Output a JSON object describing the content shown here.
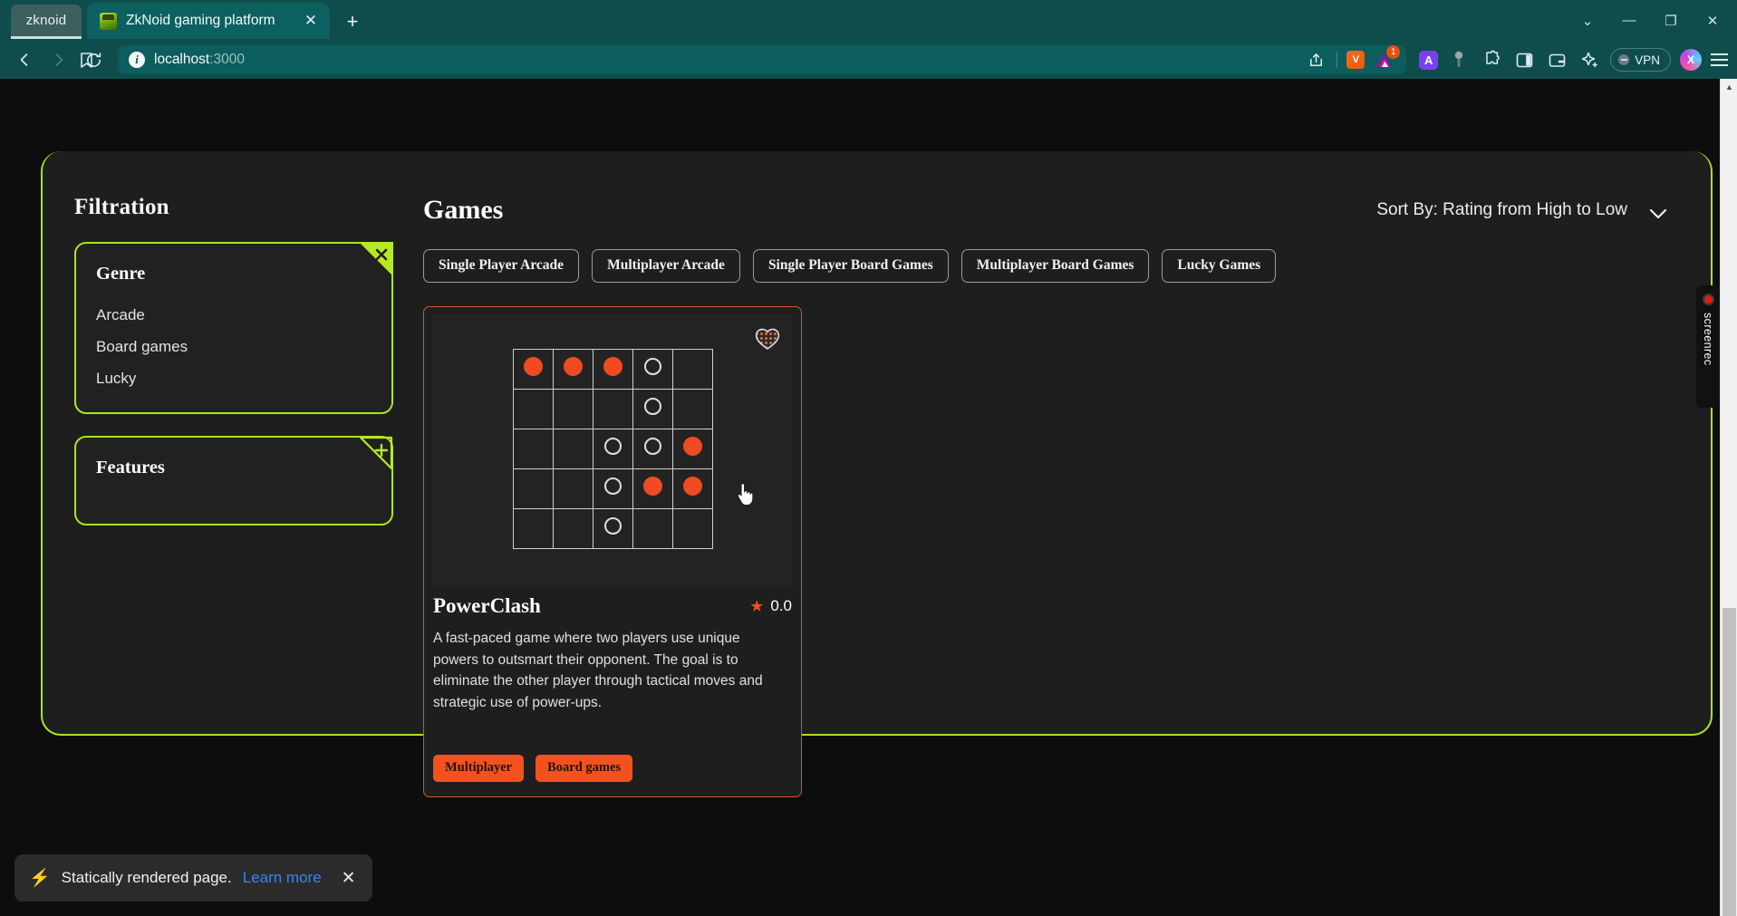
{
  "browser": {
    "workspace": "zknoid",
    "tab": {
      "title": "ZkNoid gaming platform",
      "close": "✕",
      "favicon": "zknoid-favicon"
    },
    "new_tab": "+",
    "window_controls": {
      "chevron": "⌄",
      "minimize": "—",
      "restore": "❐",
      "close": "✕"
    },
    "nav": {
      "back": "‹",
      "forward": "›",
      "reload": "⟳",
      "bookmark": "bookmark-icon"
    },
    "address": {
      "host": "localhost",
      "port": ":3000",
      "info": "i"
    },
    "toolbar_right": {
      "share": "share-icon",
      "brave_shield": "brave-shield-icon",
      "extension_badge": "1",
      "a_extension": "A",
      "profile_pin": "pin-icon",
      "puzzle": "extensions-icon",
      "sidebar": "sidebar-panel-icon",
      "wallet": "wallet-icon",
      "leo": "leo-ai-icon",
      "vpn_label": "VPN",
      "avatar": "profile-avatar",
      "menu": "hamburger-menu-icon"
    }
  },
  "sidebar": {
    "title": "Filtration",
    "genre": {
      "heading": "Genre",
      "corner_action": "✕",
      "options": [
        "Arcade",
        "Board games",
        "Lucky"
      ]
    },
    "features": {
      "heading": "Features",
      "corner_action": "+"
    }
  },
  "main": {
    "title": "Games",
    "sort": {
      "label": "Sort By: Rating from High to Low",
      "chevron": "chevron-down-icon"
    },
    "chips": [
      "Single Player Arcade",
      "Multiplayer Arcade",
      "Single Player Board Games",
      "Multiplayer Board Games",
      "Lucky Games"
    ],
    "card": {
      "favorite": "heart-icon",
      "title": "PowerClash",
      "rating_star": "★",
      "rating": "0.0",
      "description": "A fast-paced game where two players use unique powers to outsmart their opponent. The goal is to eliminate the other player through tactical moves and strategic use of power-ups.",
      "tags": [
        "Multiplayer",
        "Board games"
      ],
      "thumbnail": {
        "type": "grid-preview",
        "rows": 5,
        "cols": 5,
        "cells": [
          [
            "filled",
            "filled",
            "filled",
            "empty",
            "none"
          ],
          [
            "none",
            "none",
            "none",
            "empty",
            "none"
          ],
          [
            "none",
            "none",
            "empty",
            "empty",
            "filled"
          ],
          [
            "none",
            "none",
            "empty",
            "filled",
            "filled"
          ],
          [
            "none",
            "none",
            "empty",
            "none",
            "none"
          ]
        ],
        "filled_color": "#f04a22",
        "empty_color": "#e0e0e0"
      }
    }
  },
  "screenrec": {
    "label": "screenrec",
    "rec_dot": "record-dot"
  },
  "toast": {
    "icon": "⚡",
    "text": "Statically rendered page.",
    "link": "Learn more",
    "close": "✕"
  },
  "colors": {
    "accent_green": "#a8e521",
    "accent_orange": "#f04a22",
    "chrome_teal": "#0f4d4d",
    "page_bg": "#1e1e1e"
  }
}
